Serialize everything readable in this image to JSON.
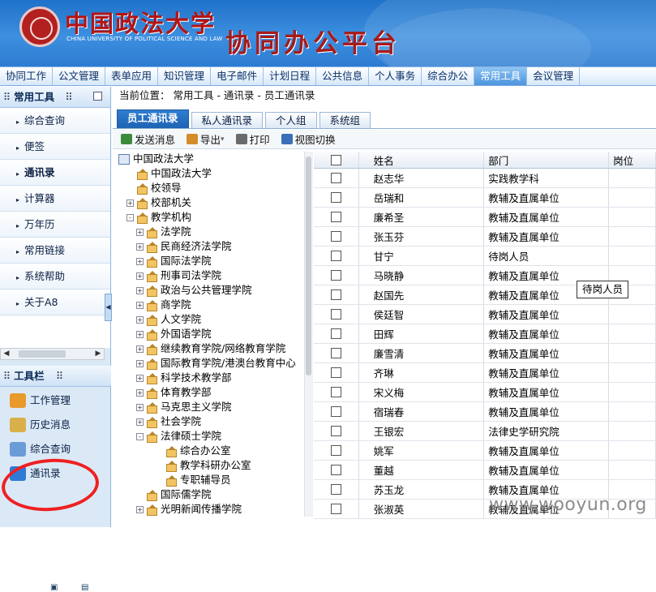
{
  "header": {
    "university_name": "中国政法大学",
    "university_name_en": "CHINA UNIVERSITY OF POLITICAL SCIENCE AND LAW",
    "platform_title": "协同办公平台"
  },
  "nav": {
    "items": [
      "协同工作",
      "公文管理",
      "表单应用",
      "知识管理",
      "电子邮件",
      "计划日程",
      "公共信息",
      "个人事务",
      "综合办公",
      "常用工具",
      "会议管理"
    ],
    "active": "常用工具"
  },
  "sidebar": {
    "title": "常用工具",
    "items": [
      "综合查询",
      "便签",
      "通讯录",
      "计算器",
      "万年历",
      "常用链接",
      "系统帮助",
      "关于A8"
    ],
    "active_item": "通讯录",
    "toolbar_title": "工具栏",
    "toolbar_items": [
      "工作管理",
      "历史消息",
      "综合查询",
      "通讯录"
    ]
  },
  "main": {
    "breadcrumb": "当前位置： 常用工具 - 通讯录 - 员工通讯录",
    "tabs": [
      "员工通讯录",
      "私人通讯录",
      "个人组",
      "系统组"
    ],
    "active_tab": "员工通讯录",
    "actions": [
      "发送消息",
      "导出",
      "打印",
      "视图切换"
    ]
  },
  "tree": {
    "nodes": [
      {
        "label": "中国政法大学",
        "level": 0,
        "toggle": "",
        "icon": "root"
      },
      {
        "label": "中国政法大学",
        "level": 1,
        "toggle": "",
        "icon": "folder"
      },
      {
        "label": "校领导",
        "level": 1,
        "toggle": "",
        "icon": "folder"
      },
      {
        "label": "校部机关",
        "level": 1,
        "toggle": "+",
        "icon": "folder"
      },
      {
        "label": "教学机构",
        "level": 1,
        "toggle": "-",
        "icon": "folder"
      },
      {
        "label": "法学院",
        "level": 2,
        "toggle": "+",
        "icon": "folder"
      },
      {
        "label": "民商经济法学院",
        "level": 2,
        "toggle": "+",
        "icon": "folder"
      },
      {
        "label": "国际法学院",
        "level": 2,
        "toggle": "+",
        "icon": "folder"
      },
      {
        "label": "刑事司法学院",
        "level": 2,
        "toggle": "+",
        "icon": "folder"
      },
      {
        "label": "政治与公共管理学院",
        "level": 2,
        "toggle": "+",
        "icon": "folder"
      },
      {
        "label": "商学院",
        "level": 2,
        "toggle": "+",
        "icon": "folder"
      },
      {
        "label": "人文学院",
        "level": 2,
        "toggle": "+",
        "icon": "folder"
      },
      {
        "label": "外国语学院",
        "level": 2,
        "toggle": "+",
        "icon": "folder"
      },
      {
        "label": "继续教育学院/网络教育学院",
        "level": 2,
        "toggle": "+",
        "icon": "folder"
      },
      {
        "label": "国际教育学院/港澳台教育中心",
        "level": 2,
        "toggle": "+",
        "icon": "folder"
      },
      {
        "label": "科学技术教学部",
        "level": 2,
        "toggle": "+",
        "icon": "folder"
      },
      {
        "label": "体育教学部",
        "level": 2,
        "toggle": "+",
        "icon": "folder"
      },
      {
        "label": "马克思主义学院",
        "level": 2,
        "toggle": "+",
        "icon": "folder"
      },
      {
        "label": "社会学院",
        "level": 2,
        "toggle": "+",
        "icon": "folder"
      },
      {
        "label": "法律硕士学院",
        "level": 2,
        "toggle": "-",
        "icon": "folder"
      },
      {
        "label": "综合办公室",
        "level": 3,
        "toggle": "",
        "icon": "folder"
      },
      {
        "label": "教学科研办公室",
        "level": 3,
        "toggle": "",
        "icon": "folder"
      },
      {
        "label": "专职辅导员",
        "level": 3,
        "toggle": "",
        "icon": "folder"
      },
      {
        "label": "国际儒学院",
        "level": 2,
        "toggle": "",
        "icon": "folder"
      },
      {
        "label": "光明新闻传播学院",
        "level": 2,
        "toggle": "+",
        "icon": "folder"
      }
    ]
  },
  "grid": {
    "columns": [
      "",
      "姓名",
      "部门",
      "岗位"
    ],
    "rows": [
      {
        "name": "赵志华",
        "dept": "实践教学科",
        "post": ""
      },
      {
        "name": "岳瑞和",
        "dept": "教辅及直属单位",
        "post": ""
      },
      {
        "name": "廉希圣",
        "dept": "教辅及直属单位",
        "post": ""
      },
      {
        "name": "张玉芬",
        "dept": "教辅及直属单位",
        "post": ""
      },
      {
        "name": "甘宁",
        "dept": "待岗人员",
        "post": ""
      },
      {
        "name": "马晓静",
        "dept": "教辅及直属单位",
        "post": ""
      },
      {
        "name": "赵国先",
        "dept": "教辅及直属单位",
        "post": ""
      },
      {
        "name": "侯廷智",
        "dept": "教辅及直属单位",
        "post": ""
      },
      {
        "name": "田辉",
        "dept": "教辅及直属单位",
        "post": ""
      },
      {
        "name": "廉雪清",
        "dept": "教辅及直属单位",
        "post": ""
      },
      {
        "name": "齐琳",
        "dept": "教辅及直属单位",
        "post": ""
      },
      {
        "name": "宋义梅",
        "dept": "教辅及直属单位",
        "post": ""
      },
      {
        "name": "宿瑞春",
        "dept": "教辅及直属单位",
        "post": ""
      },
      {
        "name": "王银宏",
        "dept": "法律史学研究院",
        "post": ""
      },
      {
        "name": "姚军",
        "dept": "教辅及直属单位",
        "post": ""
      },
      {
        "name": "董越",
        "dept": "教辅及直属单位",
        "post": ""
      },
      {
        "name": "苏玉龙",
        "dept": "教辅及直属单位",
        "post": ""
      },
      {
        "name": "张淑英",
        "dept": "教辅及直属单位",
        "post": ""
      }
    ]
  },
  "tooltip": "待岗人员",
  "watermark": "www.wooyun.org",
  "colors": {
    "header": "#2c7bd2",
    "nav_active": "#4b95de",
    "tab_active": "#1d63b4",
    "annotation": "#ef2020"
  }
}
